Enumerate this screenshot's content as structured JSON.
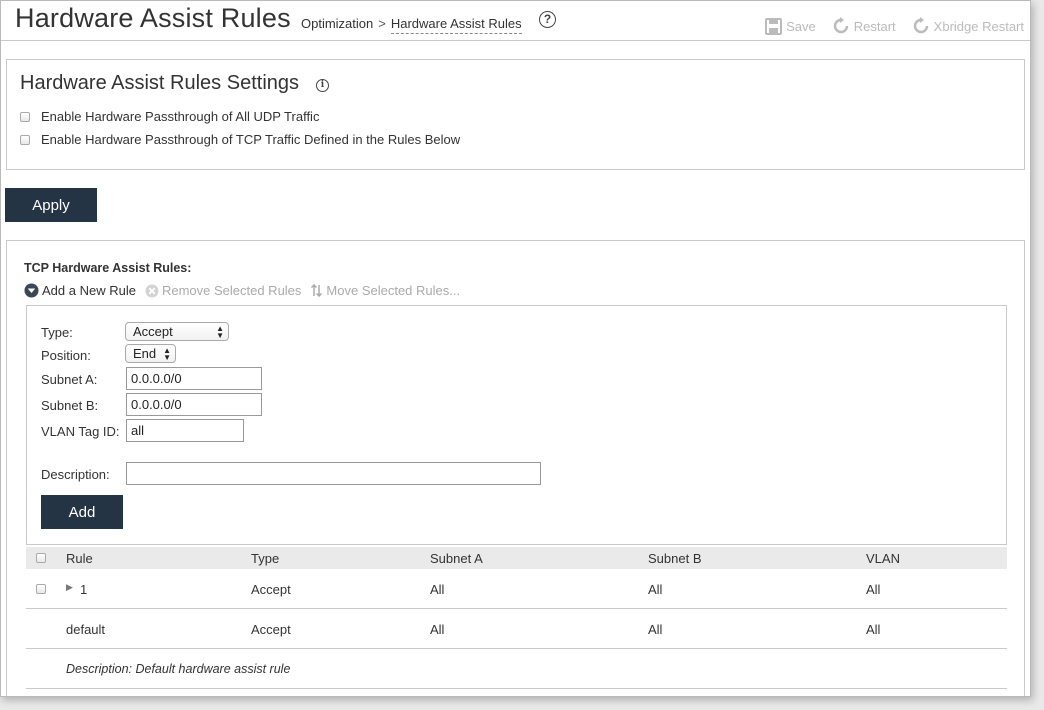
{
  "header": {
    "title": "Hardware Assist Rules",
    "breadcrumb": [
      "Optimization",
      "Hardware Assist Rules"
    ],
    "breadcrumb_separator": ">",
    "help_glyph": "?",
    "actions": [
      {
        "label": "Save",
        "icon": "save-icon"
      },
      {
        "label": "Restart",
        "icon": "restart-icon"
      },
      {
        "label": "Xbridge Restart",
        "icon": "restart-icon"
      }
    ]
  },
  "settings": {
    "title": "Hardware Assist Rules Settings",
    "info_glyph": "i",
    "checkboxes": [
      {
        "label": "Enable Hardware Passthrough of All UDP Traffic",
        "checked": false
      },
      {
        "label": "Enable Hardware Passthrough of TCP Traffic Defined in the Rules Below",
        "checked": false
      }
    ],
    "apply_label": "Apply"
  },
  "rules": {
    "title": "TCP Hardware Assist Rules:",
    "toolbar": {
      "add": "Add a New Rule",
      "remove": "Remove Selected Rules",
      "move": "Move Selected Rules..."
    },
    "form": {
      "type_label": "Type:",
      "type_value": "Accept",
      "position_label": "Position:",
      "position_value": "End",
      "subnet_a_label": "Subnet A:",
      "subnet_a_value": "0.0.0.0/0",
      "subnet_b_label": "Subnet B:",
      "subnet_b_value": "0.0.0.0/0",
      "vlan_label": "VLAN Tag ID:",
      "vlan_value": "all",
      "description_label": "Description:",
      "description_value": "",
      "add_label": "Add"
    },
    "columns": [
      "Rule",
      "Type",
      "Subnet A",
      "Subnet B",
      "VLAN"
    ],
    "rows": [
      {
        "rule": "1",
        "type": "Accept",
        "subnet_a": "All",
        "subnet_b": "All",
        "vlan": "All"
      },
      {
        "rule": "default",
        "type": "Accept",
        "subnet_a": "All",
        "subnet_b": "All",
        "vlan": "All"
      }
    ],
    "default_description": "Description: Default hardware assist rule"
  },
  "colors": {
    "button_bg": "#253445",
    "disabled_text": "#bbbbbb",
    "border": "#c9c9c9"
  }
}
